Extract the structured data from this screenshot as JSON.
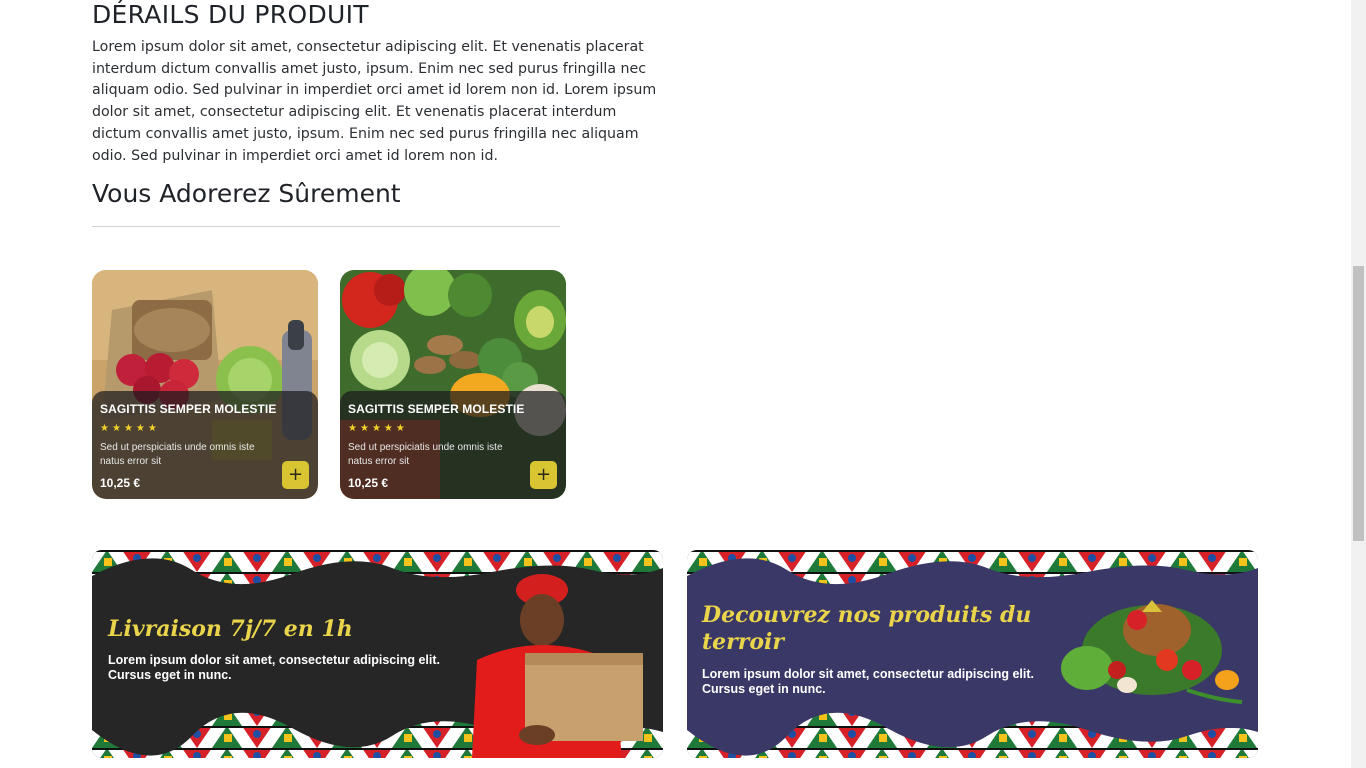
{
  "details": {
    "title": "DÉRAILS DU PRODUIT",
    "body": "Lorem ipsum dolor sit amet, consectetur adipiscing elit. Et venenatis placerat interdum dictum convallis amet justo, ipsum. Enim nec sed purus fringilla nec aliquam odio. Sed pulvinar in imperdiet orci amet id lorem non id. Lorem ipsum dolor sit amet, consectetur adipiscing elit. Et venenatis placerat interdum dictum convallis amet justo, ipsum. Enim nec sed purus fringilla nec aliquam odio. Sed pulvinar in imperdiet orci amet id lorem non id."
  },
  "suggestions": {
    "title": "Vous Adorerez Sûrement",
    "products": [
      {
        "name": "SAGITTIS SEMPER MOLESTIE",
        "rating": 5,
        "stars": [
          "★",
          "★",
          "★",
          "★",
          "★"
        ],
        "description": "Sed ut perspiciatis unde omnis iste natus error sit",
        "price": "10,25 €",
        "add_label": "+",
        "image": "grocery-bag-photo"
      },
      {
        "name": "SAGITTIS SEMPER MOLESTIE",
        "rating": 5,
        "stars": [
          "★",
          "★",
          "★",
          "★",
          "★"
        ],
        "description": "Sed ut perspiciatis unde omnis iste natus error sit",
        "price": "10,25 €",
        "add_label": "+",
        "image": "vegetables-photo"
      }
    ]
  },
  "banners": [
    {
      "title": "Livraison 7j/7 en 1h",
      "text": "Lorem ipsum dolor sit amet, consectetur adipiscing elit. Cursus eget in nunc.",
      "background": "#262626",
      "image": "delivery-man-photo"
    },
    {
      "title": "Decouvrez nos produits du terroir",
      "text": "Lorem ipsum dolor sit amet, consectetur adipiscing elit. Cursus eget in nunc.",
      "background": "#3a3866",
      "image": "vegetable-basket-photo"
    }
  ],
  "colors": {
    "accent_yellow": "#d8c531",
    "banner_title": "#e9d44b",
    "star": "#f1d02a"
  }
}
